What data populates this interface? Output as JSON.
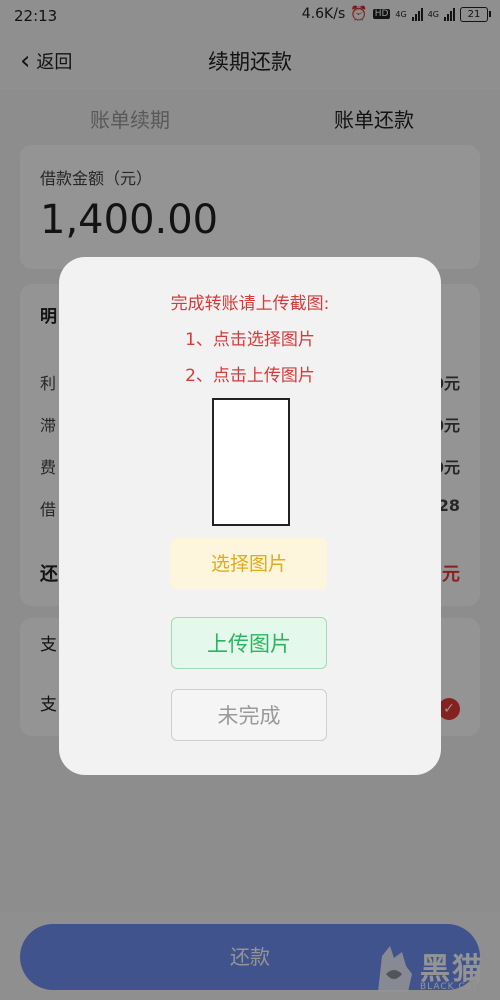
{
  "status_bar": {
    "time": "22:13",
    "net_speed": "4.6K/s",
    "hd_badge": "HD",
    "net1": "4G",
    "net2": "4G",
    "battery": "21"
  },
  "nav": {
    "back_label": "返回",
    "title": "续期还款"
  },
  "tabs": [
    {
      "label": "账单续期",
      "active": false
    },
    {
      "label": "账单还款",
      "active": true
    }
  ],
  "amount": {
    "label": "借款金额（元）",
    "value": "1,400.00"
  },
  "details": {
    "header_partial": "明",
    "rows": [
      {
        "label_partial": "利",
        "value_partial": "0元"
      },
      {
        "label_partial": "滞",
        "value_partial": "0元"
      },
      {
        "label_partial": "费",
        "value_partial": "0元"
      },
      {
        "label_partial": "借",
        "value_partial": "28"
      }
    ],
    "total_label_partial": "还",
    "total_value_partial": "元"
  },
  "payment": {
    "rows": [
      {
        "label_partial": "支"
      },
      {
        "label_partial": "支",
        "selected": true
      }
    ]
  },
  "repay_button": "还款",
  "watermark": {
    "cn": "黑猫",
    "en": "BLACK CAT"
  },
  "dialog": {
    "line1": "完成转账请上传截图:",
    "line2": "1、点击选择图片",
    "line3": "2、点击上传图片",
    "select_button": "选择图片",
    "upload_button": "上传图片",
    "not_done_button": "未完成"
  },
  "colors": {
    "accent_red": "#d83a3a",
    "primary_blue": "#6f8ff3",
    "select_yellow": "#e0ab1c",
    "upload_green": "#2db460"
  }
}
